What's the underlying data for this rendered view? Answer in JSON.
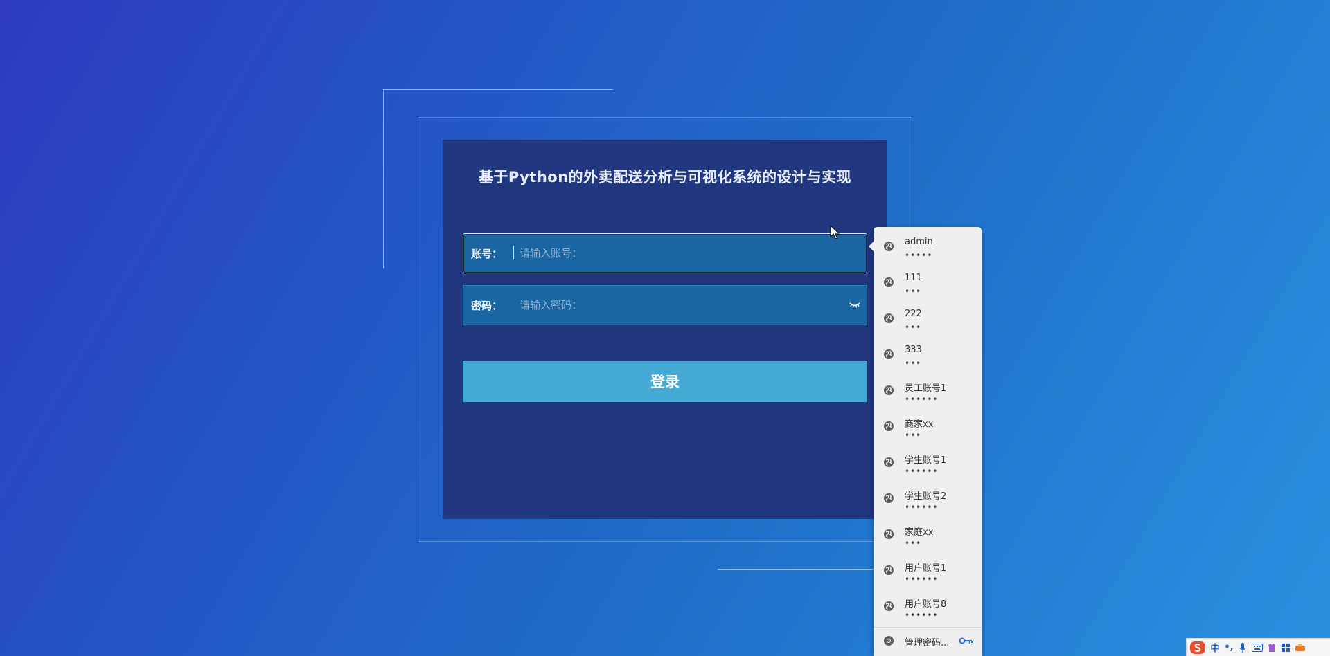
{
  "login": {
    "title": "基于Python的外卖配送分析与可视化系统的设计与实现",
    "account_label": "账号：",
    "account_placeholder": "请输入账号：",
    "password_label": "密码：",
    "password_placeholder": "请输入密码：",
    "login_button": "登录"
  },
  "password_popup": {
    "items": [
      {
        "username": "admin",
        "masked": "•••••"
      },
      {
        "username": "111",
        "masked": "•••"
      },
      {
        "username": "222",
        "masked": "•••"
      },
      {
        "username": "333",
        "masked": "•••"
      },
      {
        "username": "员工账号1",
        "masked": "••••••"
      },
      {
        "username": "商家xx",
        "masked": "•••"
      },
      {
        "username": "学生账号1",
        "masked": "••••••"
      },
      {
        "username": "学生账号2",
        "masked": "••••••"
      },
      {
        "username": "家庭xx",
        "masked": "•••"
      },
      {
        "username": "用户账号1",
        "masked": "••••••"
      },
      {
        "username": "用户账号8",
        "masked": "••••••"
      }
    ],
    "manage_label": "管理密码..."
  },
  "ime_bar": {
    "lang": "中",
    "punct": "•,"
  },
  "colors": {
    "card_bg": "#213880",
    "field_bg": "#1a66a3",
    "button_bg": "#44aad3",
    "popup_bg": "#efefef"
  }
}
